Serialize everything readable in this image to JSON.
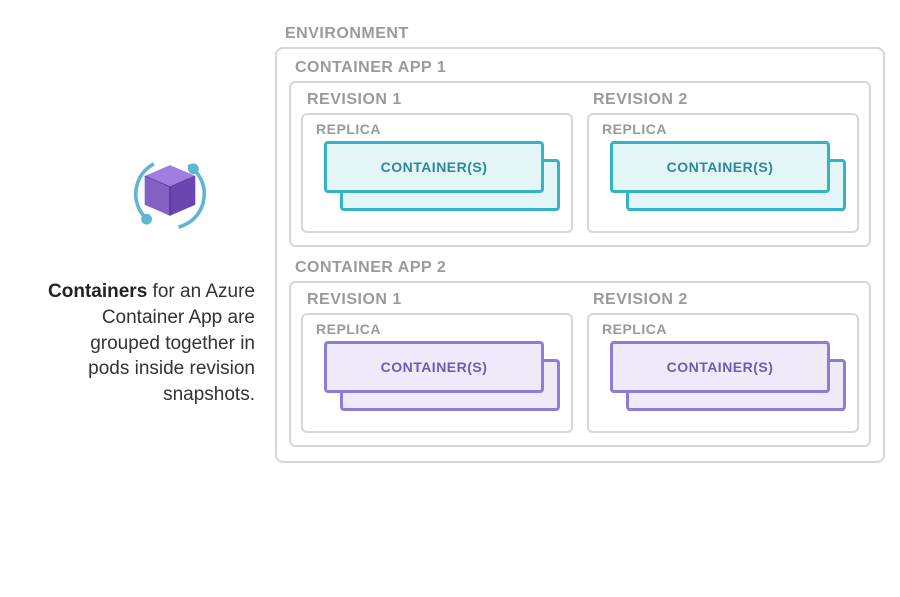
{
  "description": {
    "bold": "Containers",
    "rest": " for an Azure Container App are grouped together in pods inside revision snapshots."
  },
  "environment": {
    "label": "ENVIRONMENT",
    "apps": [
      {
        "label": "CONTAINER APP 1",
        "theme": "teal",
        "revisions": [
          {
            "label": "REVISION 1",
            "replica": "REPLICA",
            "container": "CONTAINER(S)"
          },
          {
            "label": "REVISION 2",
            "replica": "REPLICA",
            "container": "CONTAINER(S)"
          }
        ]
      },
      {
        "label": "CONTAINER APP 2",
        "theme": "purple",
        "revisions": [
          {
            "label": "REVISION 1",
            "replica": "REPLICA",
            "container": "CONTAINER(S)"
          },
          {
            "label": "REVISION 2",
            "replica": "REPLICA",
            "container": "CONTAINER(S)"
          }
        ]
      }
    ]
  }
}
